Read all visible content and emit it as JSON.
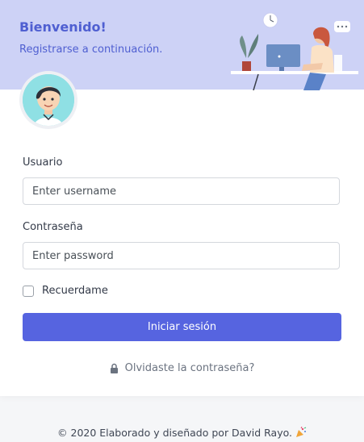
{
  "banner": {
    "title": "Bienvenido!",
    "subtitle": "Registrarse a continuación."
  },
  "form": {
    "username_label": "Usuario",
    "username_placeholder": "Enter username",
    "password_label": "Contraseña",
    "password_placeholder": "Enter password",
    "remember_label": "Recuerdame",
    "submit_label": "Iniciar sesión",
    "forgot_label": "Olvidaste la contraseña?"
  },
  "footer": {
    "text": "© 2020 Elaborado y diseñado por David Rayo."
  },
  "colors": {
    "primary": "#5664e0",
    "banner_bg": "#cdd2f6",
    "banner_text": "#4f5fd1"
  },
  "icons": {
    "forgot": "lock-icon",
    "footer": "party-popper-icon"
  }
}
